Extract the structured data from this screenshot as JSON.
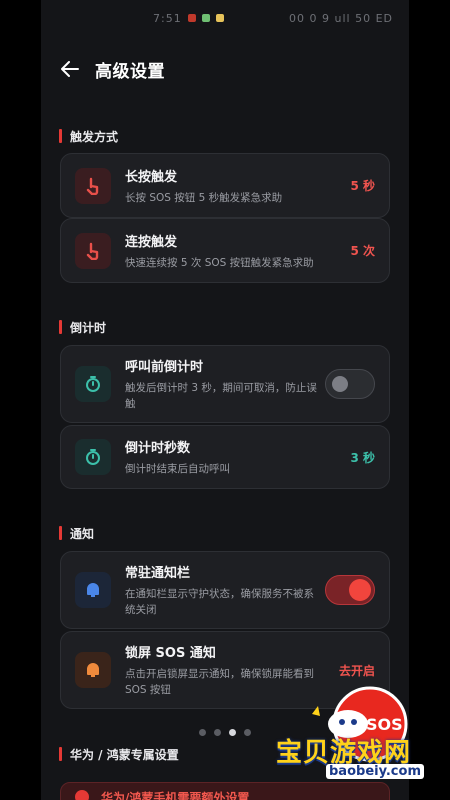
{
  "status_bar": {
    "time": "7:51",
    "right_text": "00 0 9 ull 50 ED"
  },
  "header": {
    "title": "高级设置"
  },
  "sections": {
    "trigger": "触发方式",
    "countdown": "倒计时",
    "notify": "通知",
    "huawei": "华为 / 鸿蒙专属设置"
  },
  "cards": {
    "long_press": {
      "title": "长按触发",
      "desc": "长按 SOS 按钮 5 秒触发紧急求助",
      "value": "5 秒"
    },
    "multi_press": {
      "title": "连按触发",
      "desc": "快速连续按 5 次 SOS 按钮触发紧急求助",
      "value": "5 次"
    },
    "pre_call": {
      "title": "呼叫前倒计时",
      "desc": "触发后倒计时 3 秒，期间可取消，防止误触",
      "toggle_on": false
    },
    "seconds": {
      "title": "倒计时秒数",
      "desc": "倒计时结束后自动呼叫",
      "value": "3 秒"
    },
    "resident": {
      "title": "常驻通知栏",
      "desc": "在通知栏显示守护状态，确保服务不被系统关闭",
      "toggle_on": true
    },
    "lock_sos": {
      "title": "锁屏 SOS 通知",
      "desc": "点击开启锁屏显示通知，确保锁屏能看到 SOS 按钮",
      "action": "去开启"
    }
  },
  "pager": {
    "count": 4,
    "active_index": 2
  },
  "banner": {
    "text": "华为/鸿蒙手机需要额外设置"
  },
  "watermark": {
    "text": "宝贝游戏网",
    "url": "baobeiy.com",
    "badge": "SOS"
  },
  "colors": {
    "accent_red": "#e53935",
    "accent_teal": "#3cc0aa",
    "background": "#141518",
    "card": "#1e1f23"
  }
}
